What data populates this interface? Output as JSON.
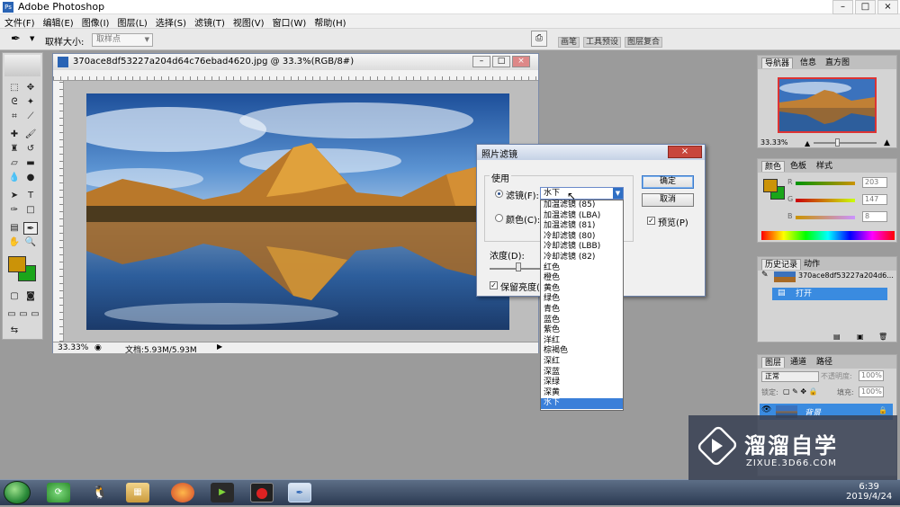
{
  "app": {
    "title": "Adobe Photoshop",
    "window_controls": [
      "–",
      "□",
      "×"
    ]
  },
  "menu": [
    "文件(F)",
    "编辑(E)",
    "图像(I)",
    "图层(L)",
    "选择(S)",
    "滤镜(T)",
    "视图(V)",
    "窗口(W)",
    "帮助(H)"
  ],
  "options_bar": {
    "sample_size_label": "取样大小:",
    "sample_size_value": "取样点",
    "palette_well_tabs": [
      "画笔",
      "工具预设",
      "图层复合"
    ]
  },
  "document": {
    "title": "370ace8df53227a204d64c76ebad4620.jpg @ 33.3%(RGB/8#)",
    "zoom": "33.33%",
    "doc_info": "文档:5.93M/5.93M"
  },
  "photo_filter_dialog": {
    "title": "照片滤镜",
    "use_label": "使用",
    "filter_label": "滤镜(F):",
    "filter_value": "水下",
    "color_label": "颜色(C):",
    "density_label": "浓度(D):",
    "preserve_label": "保留亮度(L)",
    "ok_label": "确定",
    "cancel_label": "取消",
    "preview_label": "预览(P)",
    "preview_checked": true,
    "preserve_checked": true
  },
  "filter_options": [
    "加温滤镜 (85)",
    "加温滤镜 (LBA)",
    "加温滤镜 (81)",
    "冷却滤镜 (80)",
    "冷却滤镜 (LBB)",
    "冷却滤镜 (82)",
    "红色",
    "橙色",
    "黄色",
    "绿色",
    "青色",
    "蓝色",
    "紫色",
    "洋红",
    "棕褐色",
    "深红",
    "深蓝",
    "深绿",
    "深黄",
    "水下"
  ],
  "navigator": {
    "tabs": [
      "导航器",
      "信息",
      "直方图"
    ],
    "zoom": "33.33%"
  },
  "color_panel": {
    "tabs": [
      "颜色",
      "色板",
      "样式"
    ],
    "channels": [
      {
        "label": "R",
        "value": "203"
      },
      {
        "label": "G",
        "value": "147"
      },
      {
        "label": "B",
        "value": "8"
      }
    ],
    "foreground": "#cb9308",
    "background": "#1aa51a"
  },
  "history_panel": {
    "tabs": [
      "历史记录",
      "动作"
    ],
    "snapshot_name": "370ace8df53227a204d6...",
    "states": [
      "打开"
    ]
  },
  "layers_panel": {
    "tabs": [
      "图层",
      "通道",
      "路径"
    ],
    "blend_mode": "正常",
    "opacity_label": "不透明度:",
    "opacity_value": "100%",
    "lock_label": "锁定:",
    "fill_label": "填充:",
    "fill_value": "100%",
    "layers": [
      {
        "name": "背景"
      }
    ]
  },
  "taskbar": {
    "time": "6:39",
    "date": "2019/4/24"
  },
  "watermark": {
    "brand": "溜溜自学",
    "url": "ZIXUE.3D66.COM"
  }
}
